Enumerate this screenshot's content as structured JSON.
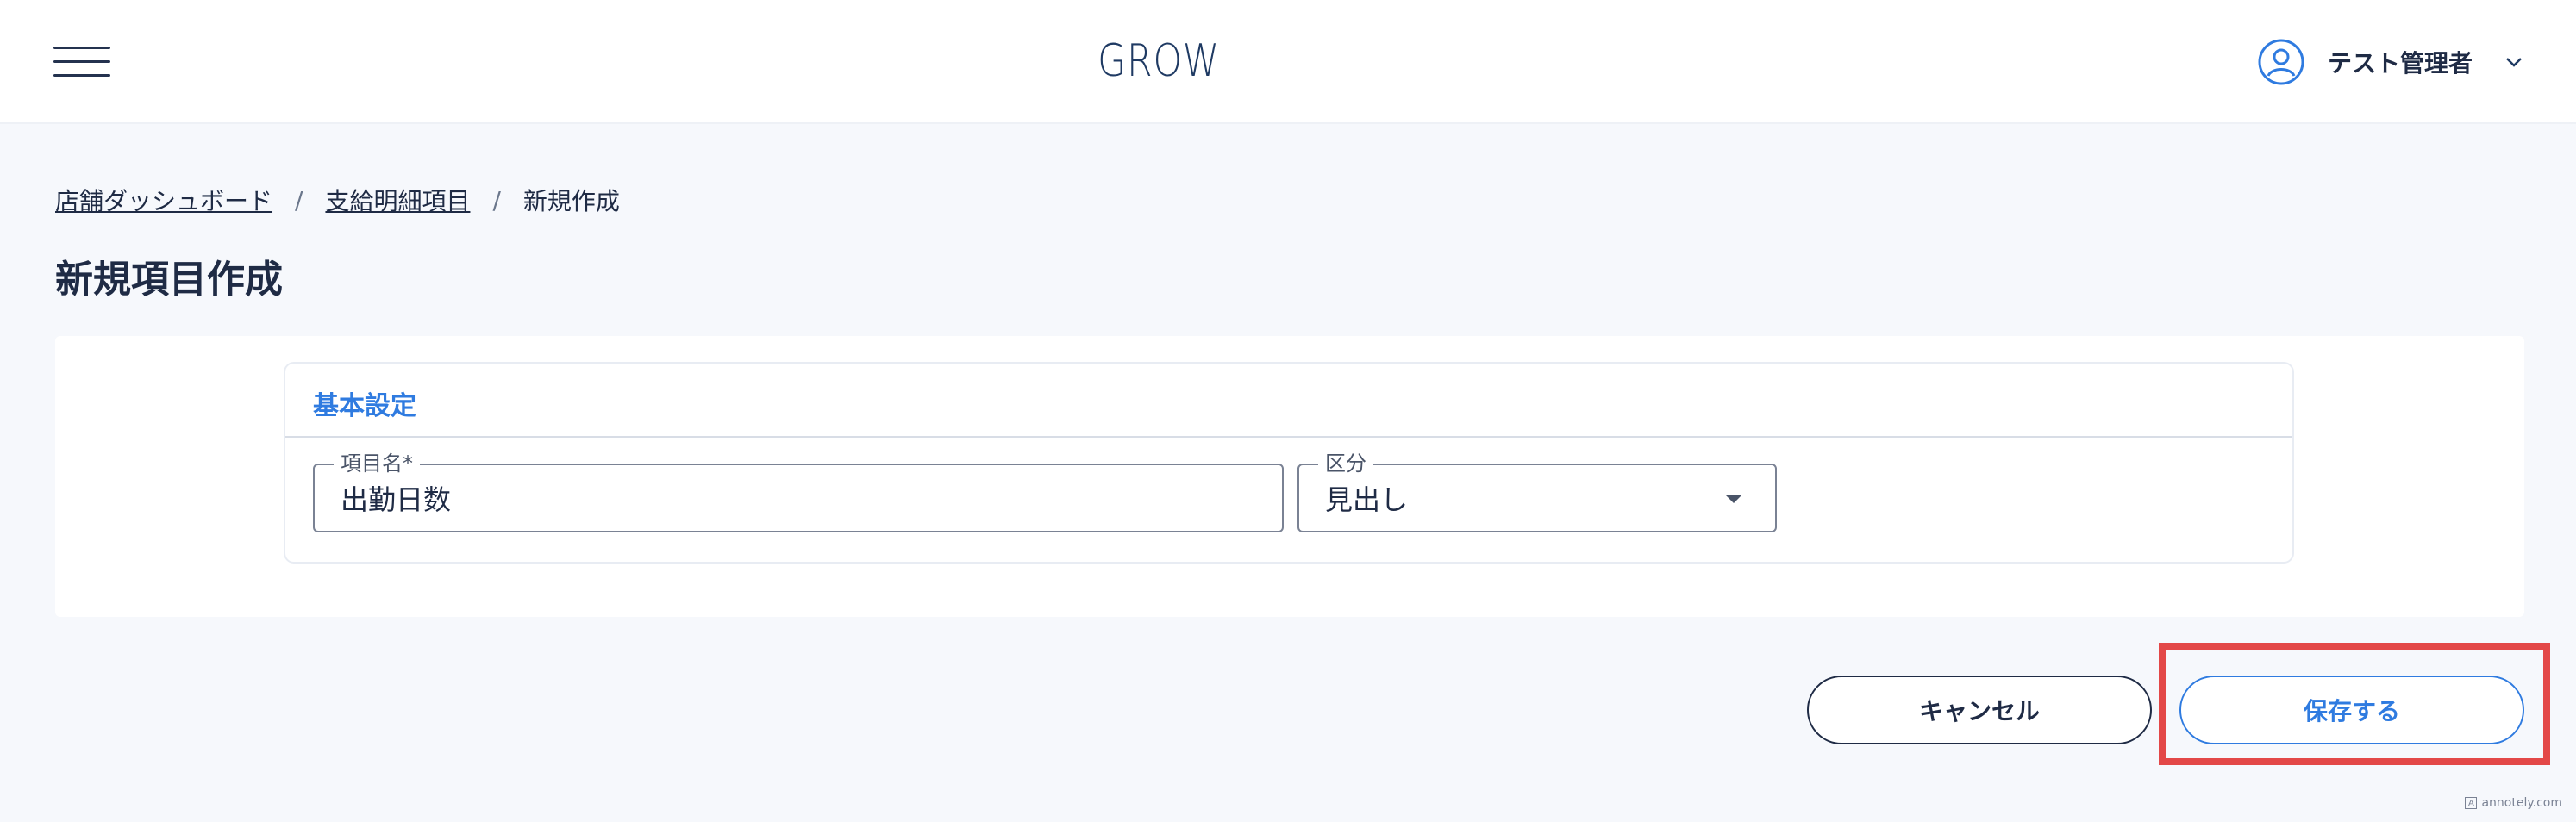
{
  "header": {
    "logo": "GROW",
    "menu_icon": "hamburger-menu-icon",
    "user_icon": "user-circle-icon",
    "user_name": "テスト管理者",
    "chevron_icon": "chevron-down-icon"
  },
  "breadcrumb": {
    "items": [
      "店舗ダッシュボード",
      "支給明細項目",
      "新規作成"
    ],
    "separator": "/"
  },
  "page": {
    "title": "新規項目作成"
  },
  "card": {
    "title": "基本設定",
    "fields": {
      "name": {
        "label": "項目名*",
        "value": "出勤日数"
      },
      "kubun": {
        "label": "区分",
        "value": "見出し",
        "caret_icon": "dropdown-caret-icon"
      }
    }
  },
  "actions": {
    "cancel_label": "キャンセル",
    "save_label": "保存する"
  },
  "annotation": {
    "highlight_color": "#e34848"
  },
  "watermark": {
    "text": "annotely.com"
  },
  "colors": {
    "accent": "#2f7be0",
    "text": "#1f2b45",
    "background": "#f6f8fc"
  }
}
